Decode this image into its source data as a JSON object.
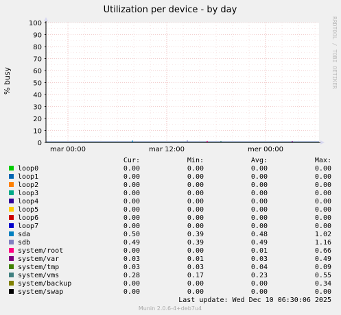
{
  "chart_data": {
    "type": "line",
    "title": "Utilization per device - by day",
    "ylabel": "% busy",
    "ylim": [
      0,
      100
    ],
    "yticks": [
      0,
      10,
      20,
      30,
      40,
      50,
      60,
      70,
      80,
      90,
      100
    ],
    "xticks": [
      "mar 00:00",
      "mar 12:00",
      "mer 00:00"
    ],
    "watermark": "RRDTOOL / TOBI OETIKER",
    "columns": [
      "Cur:",
      "Min:",
      "Avg:",
      "Max:"
    ],
    "series": [
      {
        "name": "loop0",
        "color": "#00cc00",
        "cur": "0.00",
        "min": "0.00",
        "avg": "0.00",
        "max": "0.00"
      },
      {
        "name": "loop1",
        "color": "#0066b3",
        "cur": "0.00",
        "min": "0.00",
        "avg": "0.00",
        "max": "0.00"
      },
      {
        "name": "loop2",
        "color": "#ff8000",
        "cur": "0.00",
        "min": "0.00",
        "avg": "0.00",
        "max": "0.00"
      },
      {
        "name": "loop3",
        "color": "#00aa88",
        "cur": "0.00",
        "min": "0.00",
        "avg": "0.00",
        "max": "0.00"
      },
      {
        "name": "loop4",
        "color": "#330099",
        "cur": "0.00",
        "min": "0.00",
        "avg": "0.00",
        "max": "0.00"
      },
      {
        "name": "loop5",
        "color": "#ffcc00",
        "cur": "0.00",
        "min": "0.00",
        "avg": "0.00",
        "max": "0.00"
      },
      {
        "name": "loop6",
        "color": "#cc0000",
        "cur": "0.00",
        "min": "0.00",
        "avg": "0.00",
        "max": "0.00"
      },
      {
        "name": "loop7",
        "color": "#0000cc",
        "cur": "0.00",
        "min": "0.00",
        "avg": "0.00",
        "max": "0.00"
      },
      {
        "name": "sda",
        "color": "#0080c0",
        "cur": "0.50",
        "min": "0.39",
        "avg": "0.48",
        "max": "1.02"
      },
      {
        "name": "sdb",
        "color": "#8080c0",
        "cur": "0.49",
        "min": "0.39",
        "avg": "0.49",
        "max": "1.16"
      },
      {
        "name": "system/root",
        "color": "#ff0080",
        "cur": "0.00",
        "min": "0.00",
        "avg": "0.01",
        "max": "0.66"
      },
      {
        "name": "system/var",
        "color": "#800080",
        "cur": "0.03",
        "min": "0.01",
        "avg": "0.03",
        "max": "0.49"
      },
      {
        "name": "system/tmp",
        "color": "#408000",
        "cur": "0.03",
        "min": "0.03",
        "avg": "0.04",
        "max": "0.09"
      },
      {
        "name": "system/vms",
        "color": "#408080",
        "cur": "0.28",
        "min": "0.17",
        "avg": "0.23",
        "max": "0.55"
      },
      {
        "name": "system/backup",
        "color": "#808000",
        "cur": "0.00",
        "min": "0.00",
        "avg": "0.00",
        "max": "0.34"
      },
      {
        "name": "system/swap",
        "color": "#000000",
        "cur": "0.00",
        "min": "0.00",
        "avg": "0.00",
        "max": "0.00"
      }
    ],
    "last_update": "Last update:  Wed Dec 10 06:30:06 2025",
    "footer": "Munin 2.0.6-4+deb7u4"
  }
}
